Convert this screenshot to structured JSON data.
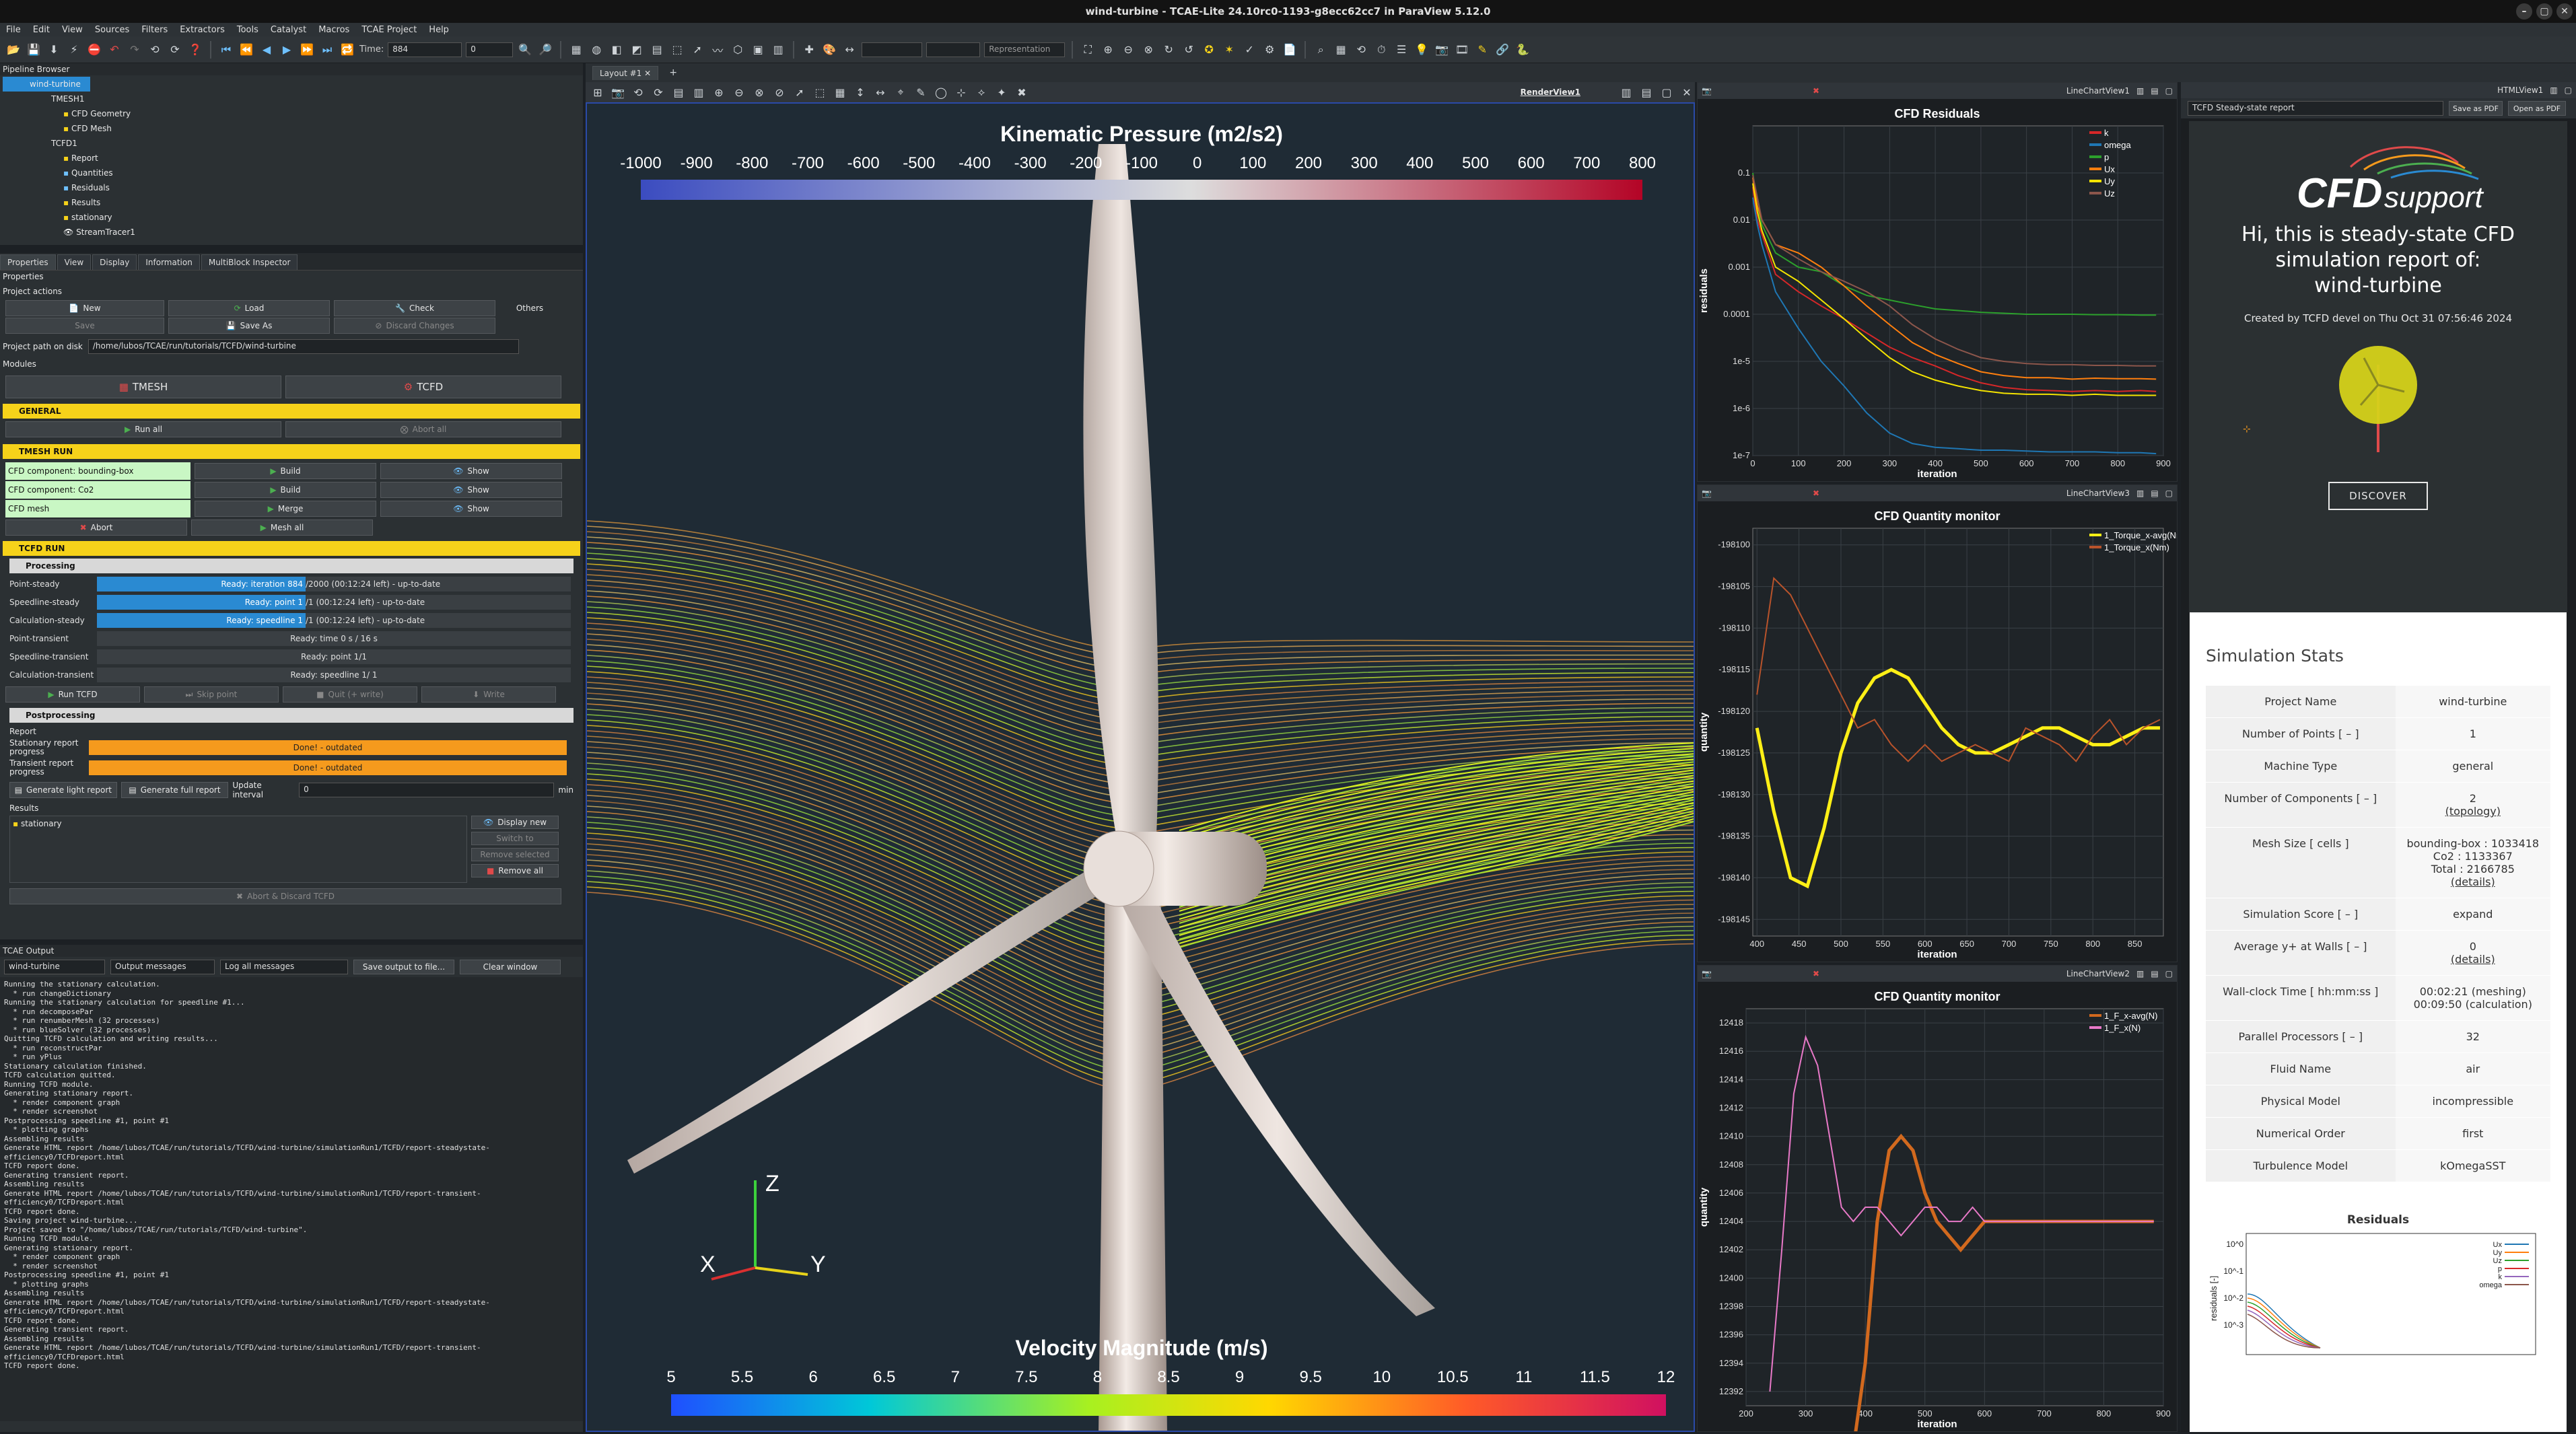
{
  "window": {
    "title": "wind-turbine - TCAE-Lite 24.10rc0-1193-g8ecc62cc7 in ParaView 5.12.0"
  },
  "menu": [
    "File",
    "Edit",
    "View",
    "Sources",
    "Filters",
    "Extractors",
    "Tools",
    "Catalyst",
    "Macros",
    "TCAE Project",
    "Help"
  ],
  "toolbar": {
    "time_label": "Time:",
    "time_value": "884",
    "time_index": "0",
    "representation": "Representation"
  },
  "pipeline": {
    "title": "Pipeline Browser",
    "items": [
      "wind-turbine",
      "TMESH1",
      "CFD Geometry",
      "CFD Mesh",
      "TCFD1",
      "Report",
      "Quantities",
      "Residuals",
      "Results",
      "stationary",
      "StreamTracer1"
    ]
  },
  "prop_tabs": [
    "Properties",
    "View",
    "Display",
    "Information",
    "MultiBlock Inspector"
  ],
  "properties": {
    "header": "Properties",
    "project_actions": "Project actions",
    "new": "New",
    "load": "Load",
    "check": "Check",
    "others": "Others",
    "save": "Save",
    "save_as": "Save As",
    "discard": "Discard Changes",
    "path_label": "Project path on disk",
    "path_value": "/home/lubos/TCAE/run/tutorials/TCFD/wind-turbine",
    "modules": "Modules",
    "tmesh": "TMESH",
    "tcfd": "TCFD",
    "general": "GENERAL",
    "run_all": "Run all",
    "abort_all": "Abort all",
    "tmesh_run": "TMESH RUN",
    "tmesh_rows": [
      {
        "label": "CFD component: bounding-box",
        "action": "Build",
        "show": "Show"
      },
      {
        "label": "CFD component: Co2",
        "action": "Build",
        "show": "Show"
      },
      {
        "label": "CFD mesh",
        "action": "Merge",
        "show": "Show"
      }
    ],
    "abort": "Abort",
    "mesh_all": "Mesh all",
    "tcfd_run": "TCFD RUN",
    "processing": "Processing",
    "proc_rows": [
      {
        "label": "Point-steady",
        "bar": "Ready: iteration 884",
        "text": "/2000 (00:12:24 left) - up-to-date",
        "frac": 0.44
      },
      {
        "label": "Speedline-steady",
        "bar": "Ready: point 1",
        "text": "/1 (00:12:24 left) - up-to-date",
        "frac": 0.44
      },
      {
        "label": "Calculation-steady",
        "bar": "Ready: speedline 1",
        "text": "/1 (00:12:24 left) - up-to-date",
        "frac": 0.44
      },
      {
        "label": "Point-transient",
        "bar": "",
        "text": "Ready: time 0 s / 16 s",
        "frac": 0
      },
      {
        "label": "Speedline-transient",
        "bar": "",
        "text": "Ready: point 1/1",
        "frac": 0
      },
      {
        "label": "Calculation-transient",
        "bar": "",
        "text": "Ready: speedline 1/ 1",
        "frac": 0
      }
    ],
    "run_tcfd": "Run TCFD",
    "skip_point": "Skip point",
    "quit_write": "Quit (+ write)",
    "write": "Write",
    "postprocessing": "Postprocessing",
    "report": "Report",
    "stationary_report": "Stationary report progress",
    "stationary_status": "Done! - outdated",
    "transient_report": "Transient report progress",
    "transient_status": "Done! - outdated",
    "gen_light": "Generate light report",
    "gen_full": "Generate full report",
    "update_interval": "Update interval",
    "update_value": "0",
    "min": "min",
    "results": "Results",
    "result_item": "stationary",
    "display_new": "Display new",
    "switch_to": "Switch to",
    "remove_selected": "Remove selected",
    "remove_all": "Remove all",
    "abort_discard": "Abort & Discard TCFD"
  },
  "output": {
    "title": "TCAE Output",
    "project": "wind-turbine",
    "messages": "Output messages",
    "log": "Log all messages",
    "save": "Save output to file...",
    "clear": "Clear window",
    "lines": [
      "Running the stationary calculation.",
      "  * run changeDictionary",
      "Running the stationary calculation for speedline #1...",
      "  * run decomposePar",
      "  * run renumberMesh (32 processes)",
      "  * run blueSolver (32 processes)",
      "Quitting TCFD calculation and writing results...",
      "  * run reconstructPar",
      "  * run yPlus",
      "Stationary calculation finished.",
      "TCFD calculation quitted.",
      "Running TCFD module.",
      "Generating stationary report.",
      "  * render component graph",
      "  * render screenshot",
      "Postprocessing speedline #1, point #1",
      "  * plotting graphs",
      "Assembling results",
      "Generate HTML report /home/lubos/TCAE/run/tutorials/TCFD/wind-turbine/simulationRun1/TCFD/report-steadystate-",
      "efficiency0/TCFDreport.html",
      "TCFD report done.",
      "Generating transient report.",
      "Assembling results",
      "Generate HTML report /home/lubos/TCAE/run/tutorials/TCFD/wind-turbine/simulationRun1/TCFD/report-transient-",
      "efficiency0/TCFDreport.html",
      "TCFD report done.",
      "Saving project wind-turbine...",
      "Project saved to \"/home/lubos/TCAE/run/tutorials/TCFD/wind-turbine\".",
      "Running TCFD module.",
      "Generating stationary report.",
      "  * render component graph",
      "  * render screenshot",
      "Postprocessing speedline #1, point #1",
      "  * plotting graphs",
      "Assembling results",
      "Generate HTML report /home/lubos/TCAE/run/tutorials/TCFD/wind-turbine/simulationRun1/TCFD/report-steadystate-",
      "efficiency0/TCFDreport.html",
      "TCFD report done.",
      "Generating transient report.",
      "Assembling results",
      "Generate HTML report /home/lubos/TCAE/run/tutorials/TCFD/wind-turbine/simulationRun1/TCFD/report-transient-",
      "efficiency0/TCFDreport.html",
      "TCFD report done."
    ]
  },
  "layout_tab": "Layout #1",
  "render": {
    "view_name": "RenderView1",
    "pressure_title": "Kinematic Pressure (m2/s2)",
    "pressure_ticks": [
      "-1000",
      "-900",
      "-800",
      "-700",
      "-600",
      "-500",
      "-400",
      "-300",
      "-200",
      "-100",
      "0",
      "100",
      "200",
      "300",
      "400",
      "500",
      "600",
      "700",
      "800"
    ],
    "velocity_title": "Velocity Magnitude (m/s)",
    "velocity_ticks": [
      "5",
      "5.5",
      "6",
      "6.5",
      "7",
      "7.5",
      "8",
      "8.5",
      "9",
      "9.5",
      "10",
      "10.5",
      "11",
      "11.5",
      "12"
    ],
    "axes": {
      "z": "Z",
      "x": "X",
      "y": "Y"
    }
  },
  "chart_views": [
    "LineChartView1",
    "LineChartView3",
    "LineChartView2"
  ],
  "html_view": {
    "name": "HTMLView1",
    "report_select": "TCFD Steady-state report",
    "save_pdf": "Save as PDF",
    "open_pdf": "Open as PDF"
  },
  "chart_data": [
    {
      "type": "line",
      "title": "CFD Residuals",
      "xlabel": "iteration",
      "ylabel": "residuals",
      "log_y": true,
      "xlim": [
        0,
        900
      ],
      "ylim": [
        1e-07,
        1
      ],
      "x_ticks": [
        "0",
        "100",
        "200",
        "300",
        "400",
        "500",
        "600",
        "700",
        "800",
        "900"
      ],
      "y_ticks": [
        "1e-7",
        "1e-6",
        "1e-5",
        "0.0001",
        "0.001",
        "0.01",
        "0.1"
      ],
      "x": [
        0,
        10,
        20,
        50,
        100,
        150,
        200,
        250,
        300,
        350,
        400,
        450,
        500,
        550,
        600,
        650,
        700,
        750,
        800,
        850,
        884
      ],
      "series": [
        {
          "name": "k",
          "color": "#d62728",
          "values": [
            0.05,
            0.01,
            0.005,
            0.0007,
            0.0003,
            0.00015,
            8e-05,
            4e-05,
            2e-05,
            1.2e-05,
            8e-06,
            5e-06,
            3.5e-06,
            2.8e-06,
            2.5e-06,
            2.4e-06,
            2.3e-06,
            2.4e-06,
            2.3e-06,
            2.4e-06,
            2.3e-06
          ]
        },
        {
          "name": "omega",
          "color": "#1f77b4",
          "values": [
            0.03,
            0.008,
            0.003,
            0.0003,
            5e-05,
            1e-05,
            3e-06,
            8e-07,
            3e-07,
            1.8e-07,
            1.5e-07,
            1.4e-07,
            1.3e-07,
            1.3e-07,
            1.25e-07,
            1.2e-07,
            1.2e-07,
            1.2e-07,
            1.15e-07,
            1.15e-07,
            1.1e-07
          ]
        },
        {
          "name": "p",
          "color": "#2ca02c",
          "values": [
            0.1,
            0.02,
            0.008,
            0.002,
            0.001,
            0.0008,
            0.0004,
            0.00025,
            0.0002,
            0.00016,
            0.00013,
            0.00012,
            0.00011,
            0.000105,
            0.0001,
            0.0001,
            0.0001,
            9.8e-05,
            9.8e-05,
            9.6e-05,
            9.6e-05
          ]
        },
        {
          "name": "Ux",
          "color": "#ff7f0e",
          "values": [
            0.08,
            0.02,
            0.01,
            0.003,
            0.002,
            0.001,
            0.0004,
            0.00015,
            6e-05,
            2.5e-05,
            1.4e-05,
            9e-06,
            6e-06,
            5e-06,
            4.5e-06,
            4.5e-06,
            4.2e-06,
            4.4e-06,
            4.3e-06,
            4.3e-06,
            4.2e-06
          ]
        },
        {
          "name": "Uy",
          "color": "#f4e300",
          "values": [
            0.06,
            0.015,
            0.006,
            0.001,
            0.0005,
            0.0002,
            8e-05,
            3e-05,
            1.2e-05,
            6e-06,
            4e-06,
            3e-06,
            2.4e-06,
            2.1e-06,
            2e-06,
            2e-06,
            1.9e-06,
            2e-06,
            1.9e-06,
            1.9e-06,
            1.9e-06
          ]
        },
        {
          "name": "Uz",
          "color": "#8c564b",
          "values": [
            0.09,
            0.03,
            0.01,
            0.003,
            0.0015,
            0.0008,
            0.0005,
            0.0003,
            0.00015,
            6e-05,
            3e-05,
            1.8e-05,
            1.2e-05,
            1e-05,
            9e-06,
            8.5e-06,
            8.5e-06,
            8.2e-06,
            8.2e-06,
            8e-06,
            8e-06
          ]
        }
      ]
    },
    {
      "type": "line",
      "title": "CFD Quantity monitor",
      "xlabel": "iteration",
      "ylabel": "quantity",
      "xlim": [
        395,
        884
      ],
      "ylim": [
        -198147,
        -198098
      ],
      "x_ticks": [
        "400",
        "450",
        "500",
        "550",
        "600",
        "650",
        "700",
        "750",
        "800",
        "850"
      ],
      "y_ticks": [
        "-198100",
        "-198105",
        "-198110",
        "-198115",
        "-198120",
        "-198125",
        "-198130",
        "-198135",
        "-198140",
        "-198145"
      ],
      "x": [
        400,
        420,
        440,
        460,
        480,
        500,
        520,
        540,
        560,
        580,
        600,
        620,
        640,
        660,
        680,
        700,
        720,
        740,
        760,
        780,
        800,
        820,
        840,
        860,
        880
      ],
      "series": [
        {
          "name": "1_Torque_x-avg(Nm)",
          "color": "#ffef16",
          "values": [
            -198122,
            -198132,
            -198140,
            -198141,
            -198134,
            -198125,
            -198119,
            -198116,
            -198115,
            -198116,
            -198119,
            -198122,
            -198124,
            -198125,
            -198125,
            -198124,
            -198123,
            -198122,
            -198122,
            -198123,
            -198124,
            -198124,
            -198123,
            -198122,
            -198122
          ]
        },
        {
          "name": "1_Torque_x(Nm)",
          "color": "#b8532b",
          "values": [
            -198118,
            -198104,
            -198106,
            -198110,
            -198114,
            -198118,
            -198122,
            -198121,
            -198124,
            -198126,
            -198124,
            -198126,
            -198125,
            -198124,
            -198125,
            -198126,
            -198122,
            -198123,
            -198124,
            -198126,
            -198123,
            -198121,
            -198124,
            -198122,
            -198121
          ]
        }
      ]
    },
    {
      "type": "line",
      "title": "CFD Quantity monitor",
      "xlabel": "iteration",
      "ylabel": "quantity",
      "xlim": [
        200,
        900
      ],
      "ylim": [
        12391,
        12419
      ],
      "x_ticks": [
        "200",
        "300",
        "400",
        "500",
        "600",
        "700",
        "800",
        "900"
      ],
      "y_ticks": [
        "12392",
        "12394",
        "12396",
        "12398",
        "12400",
        "12402",
        "12404",
        "12406",
        "12408",
        "12410",
        "12412",
        "12414",
        "12416",
        "12418"
      ],
      "x": [
        240,
        260,
        280,
        300,
        320,
        340,
        360,
        380,
        400,
        420,
        440,
        460,
        480,
        500,
        520,
        540,
        560,
        580,
        600,
        650,
        700,
        750,
        800,
        850,
        884
      ],
      "series": [
        {
          "name": "1_F_x-avg(N)",
          "color": "#d2691e",
          "values": [
            null,
            null,
            null,
            null,
            null,
            null,
            null,
            12388,
            12394,
            12404,
            12409,
            12410,
            12409,
            12406,
            12404,
            12403,
            12402,
            12403,
            12404,
            12404,
            12404,
            12404,
            12404,
            12404,
            12404
          ]
        },
        {
          "name": "1_F_x(N)",
          "color": "#e879c8",
          "values": [
            12392,
            12402,
            12413,
            12417,
            12415,
            12410,
            12405,
            12404,
            12405,
            12405,
            12404,
            12403,
            12404,
            12405,
            12405,
            12404,
            12404,
            12405,
            12404,
            12404,
            12404,
            12404,
            12404,
            12404,
            12404
          ]
        }
      ]
    },
    {
      "type": "line",
      "title": "Residuals",
      "ylabel": "residuals [-]",
      "log_y": true,
      "y_ticks": [
        "10^0",
        "10^-1",
        "10^-2",
        "10^-3"
      ],
      "legend": [
        "Ux",
        "Uy",
        "Uz",
        "p",
        "k",
        "omega"
      ]
    }
  ],
  "report": {
    "logo_text": "CFDsupport",
    "greeting_line1": "Hi, this is steady-state CFD",
    "greeting_line2": "simulation report of:",
    "greeting_line3": "wind-turbine",
    "created": "Created by TCFD devel on Thu Oct 31 07:56:46 2024",
    "discover": "DISCOVER",
    "stats_title": "Simulation Stats",
    "stats": [
      {
        "k": "Project Name",
        "v": "wind-turbine"
      },
      {
        "k": "Number of Points [ – ]",
        "v": "1"
      },
      {
        "k": "Machine Type",
        "v": "general"
      },
      {
        "k": "Number of Components [ – ]",
        "v": "2",
        "extra": "(topology)"
      },
      {
        "k": "Mesh Size [ cells ]",
        "v": "bounding-box : 1033418",
        "v2": "Co2 : 1133367",
        "v3": "Total : 2166785",
        "extra": "(details)"
      },
      {
        "k": "Simulation Score [ – ]",
        "v": "expand"
      },
      {
        "k": "Average y+ at Walls [ – ]",
        "v": "0",
        "extra": "(details)"
      },
      {
        "k": "Wall-clock Time [ hh:mm:ss ]",
        "v": "00:02:21 (meshing)",
        "v2": "00:09:50 (calculation)"
      },
      {
        "k": "Parallel Processors [ – ]",
        "v": "32"
      },
      {
        "k": "Fluid Name",
        "v": "air"
      },
      {
        "k": "Physical Model",
        "v": "incompressible"
      },
      {
        "k": "Numerical Order",
        "v": "first"
      },
      {
        "k": "Turbulence Model",
        "v": "kOmegaSST"
      }
    ]
  }
}
